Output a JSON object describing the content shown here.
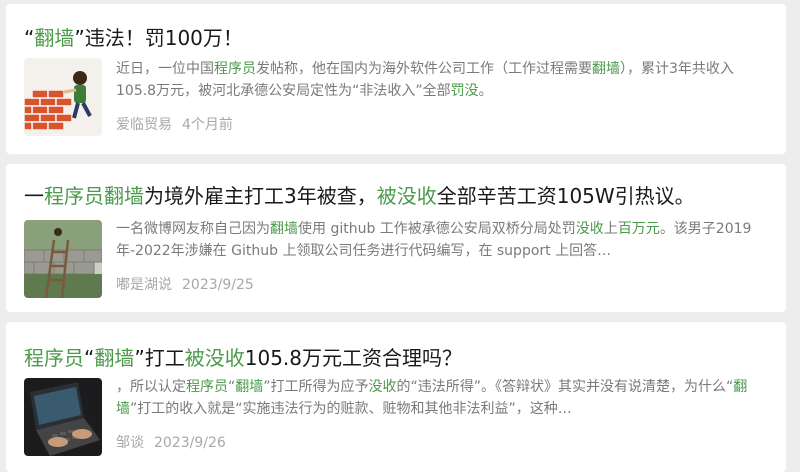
{
  "articles": [
    {
      "title": [
        {
          "t": "“",
          "hl": false
        },
        {
          "t": "翻墙",
          "hl": true
        },
        {
          "t": "”违法！罚100万！",
          "hl": false
        }
      ],
      "excerpt": [
        {
          "t": "近日，一位中国",
          "hl": false
        },
        {
          "t": "程序员",
          "hl": true
        },
        {
          "t": "发帖称，他在国内为海外软件公司工作（工作过程需要",
          "hl": false
        },
        {
          "t": "翻墙",
          "hl": true
        },
        {
          "t": "），累计3年共收入105.8万元，被河北承德公安局定性为“非法收入”全部",
          "hl": false
        },
        {
          "t": "罚没",
          "hl": true
        },
        {
          "t": "。",
          "hl": false
        }
      ],
      "source": "爱临贸易",
      "time": "4个月前",
      "thumb_icon": "brick-wall-climber-image"
    },
    {
      "title": [
        {
          "t": "一",
          "hl": false
        },
        {
          "t": "程序员",
          "hl": true
        },
        {
          "t": "翻墙",
          "hl": true
        },
        {
          "t": "为境外雇主打工3年被查，",
          "hl": false
        },
        {
          "t": "被没收",
          "hl": true
        },
        {
          "t": "全部辛苦工资105W引热议。",
          "hl": false
        }
      ],
      "excerpt": [
        {
          "t": "一名微博网友称自己因为",
          "hl": false
        },
        {
          "t": "翻墙",
          "hl": true
        },
        {
          "t": "使用 github 工作被承德公安局双桥分局处罚",
          "hl": false
        },
        {
          "t": "没收",
          "hl": true
        },
        {
          "t": "上",
          "hl": false
        },
        {
          "t": "百万元",
          "hl": true
        },
        {
          "t": "。该男子2019年-2022年涉嫌在 Github 上领取公司任务进行代码编写，在 support 上回答…",
          "hl": false
        }
      ],
      "source": "嘟是湖说",
      "time": "2023/9/25",
      "thumb_icon": "ladder-wall-image"
    },
    {
      "title": [
        {
          "t": "程序员",
          "hl": true
        },
        {
          "t": "“",
          "hl": false
        },
        {
          "t": "翻墙",
          "hl": true
        },
        {
          "t": "”打工",
          "hl": false
        },
        {
          "t": "被没收",
          "hl": true
        },
        {
          "t": "105.8万元工资合理吗？",
          "hl": false
        }
      ],
      "excerpt": [
        {
          "t": "，所以认定",
          "hl": false
        },
        {
          "t": "程序员",
          "hl": true
        },
        {
          "t": "“",
          "hl": false
        },
        {
          "t": "翻墙",
          "hl": true
        },
        {
          "t": "”打工所得为应予",
          "hl": false
        },
        {
          "t": "没收",
          "hl": true
        },
        {
          "t": "的“违法所得”。《答辩状》其实并没有说清楚，为什么“",
          "hl": false
        },
        {
          "t": "翻墙",
          "hl": true
        },
        {
          "t": "”打工的收入就是“实施违法行为的赃款、赃物和其他非法利益”，这种…",
          "hl": false
        }
      ],
      "source": "邹谈",
      "time": "2023/9/26",
      "thumb_icon": "laptop-typing-image"
    }
  ],
  "colors": {
    "highlight": "#4a9a4a",
    "title": "#191919",
    "excerpt": "#7a7a7a",
    "meta": "#a8a8a8",
    "background": "#ededed"
  }
}
